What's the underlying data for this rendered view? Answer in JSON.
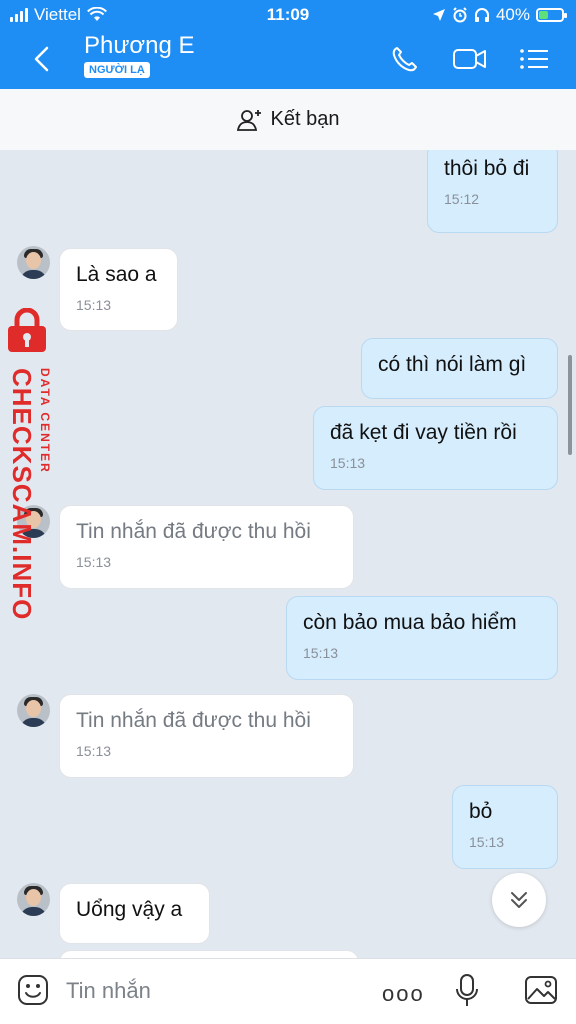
{
  "status_bar": {
    "carrier": "Viettel",
    "time": "11:09",
    "battery_percent": "40%",
    "battery_level": 0.4,
    "icons": [
      "signal-icon",
      "wifi-icon",
      "location-icon",
      "alarm-icon",
      "headphones-icon",
      "battery-charging-icon"
    ]
  },
  "header": {
    "contact_name": "Phương E",
    "badge": "NGƯỜI LẠ",
    "back_icon": "chevron-left-icon",
    "actions": [
      "phone-icon",
      "video-call-icon",
      "menu-icon"
    ]
  },
  "add_friend": {
    "label": "Kết bạn",
    "icon": "add-user-icon"
  },
  "messages": [
    {
      "type": "sent",
      "text": "thôi bỏ đi",
      "time": "15:12"
    },
    {
      "type": "received",
      "text": "Là sao a",
      "time": "15:13"
    },
    {
      "type": "sent",
      "text": "có thì nói làm gì",
      "time": ""
    },
    {
      "type": "sent",
      "text": "đã kẹt đi vay tiền rồi",
      "time": "15:13"
    },
    {
      "type": "received",
      "text": "Tin nhắn đã được thu hồi",
      "time": "15:13",
      "recalled": true
    },
    {
      "type": "sent",
      "text": "còn bảo mua bảo hiểm",
      "time": "15:13"
    },
    {
      "type": "received",
      "text": "Tin nhắn đã được thu hồi",
      "time": "15:13",
      "recalled": true
    },
    {
      "type": "sent",
      "text": "bỏ",
      "time": "15:13"
    },
    {
      "type": "received",
      "text": "Uổng vậy a",
      "time": ""
    }
  ],
  "watermark": {
    "main": "CHECKSCAM.INFO",
    "sub": "DATA CENTER",
    "color": "#e02b2b"
  },
  "input_bar": {
    "placeholder": "Tin nhắn",
    "more_label": "ooo",
    "icons": [
      "emoji-icon",
      "more-icon",
      "microphone-icon",
      "image-icon"
    ]
  },
  "colors": {
    "header_bg": "#1e8ef5",
    "sent_bubble": "#d5edfd",
    "received_bubble": "#ffffff",
    "chat_bg": "#e2e8ef"
  }
}
